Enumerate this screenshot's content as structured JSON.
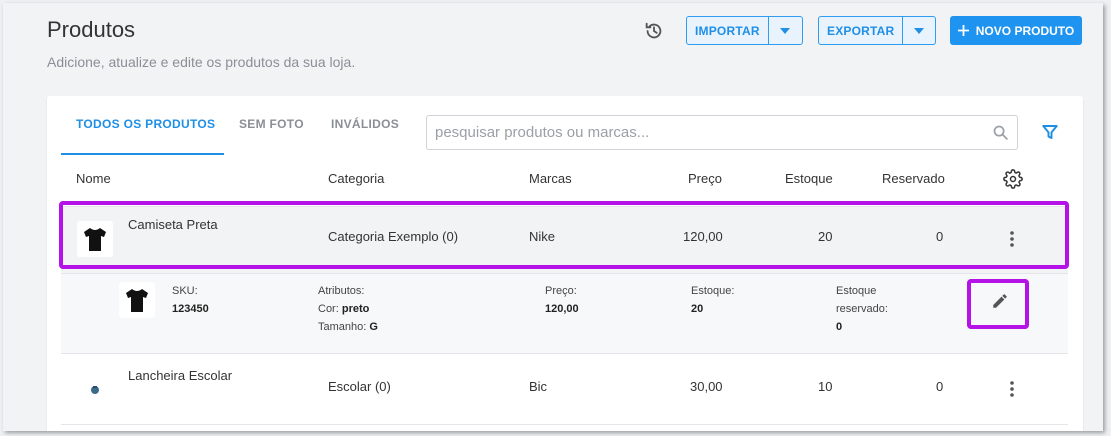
{
  "page": {
    "title": "Produtos",
    "subtitle": "Adicione, atualize e edite os produtos da sua loja."
  },
  "toolbar": {
    "import_label": "IMPORTAR",
    "export_label": "EXPORTAR",
    "new_product_label": "NOVO PRODUTO"
  },
  "tabs": [
    {
      "label": "TODOS OS PRODUTOS",
      "active": true
    },
    {
      "label": "SEM FOTO",
      "active": false
    },
    {
      "label": "INVÁLIDOS",
      "active": false
    }
  ],
  "search": {
    "placeholder": "pesquisar produtos ou marcas...",
    "value": ""
  },
  "table": {
    "columns": [
      "Nome",
      "Categoria",
      "Marcas",
      "Preço",
      "Estoque",
      "Reservado"
    ],
    "rows": [
      {
        "name": "Camiseta Preta",
        "category": "Categoria Exemplo (0)",
        "brand": "Nike",
        "price": "120,00",
        "stock": "20",
        "reserved": "0",
        "expanded": true,
        "detail": {
          "sku_label": "SKU:",
          "sku": "123450",
          "attributes_label": "Atributos:",
          "color_label": "Cor:",
          "color": "preto",
          "size_label": "Tamanho:",
          "size": "G",
          "price_label": "Preço:",
          "price": "120,00",
          "stock_label": "Estoque:",
          "stock": "20",
          "reserved_label_1": "Estoque",
          "reserved_label_2": "reservado:",
          "reserved": "0"
        }
      },
      {
        "name": "Lancheira Escolar",
        "category": "Escolar (0)",
        "brand": "Bic",
        "price": "30,00",
        "stock": "10",
        "reserved": "0",
        "expanded": false
      }
    ]
  },
  "colors": {
    "accent": "#1f8fe5",
    "highlight": "#b512e8",
    "background": "#f2f3f5"
  },
  "icons": [
    "history-icon",
    "chevron-down-icon",
    "plus-icon",
    "search-icon",
    "filter-icon",
    "gear-icon",
    "more-vert-icon",
    "pencil-icon",
    "tshirt-icon",
    "lunchbox-icon"
  ]
}
